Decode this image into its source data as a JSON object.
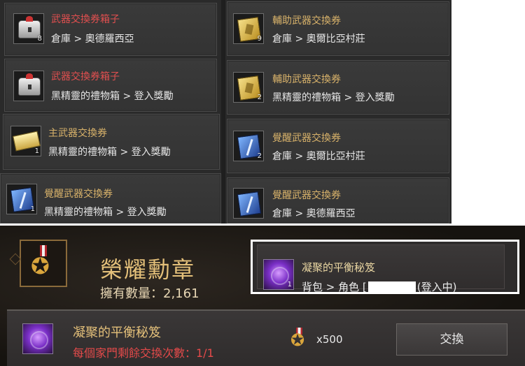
{
  "item_list": {
    "left": [
      {
        "name": "武器交換券箱子",
        "location": "倉庫 > 奧德羅西亞",
        "count": "8",
        "icon": "chest-icon",
        "name_color": "#e14f4f"
      },
      {
        "name": "武器交換券箱子",
        "location": "黑精靈的禮物箱 > 登入獎勵",
        "count": "",
        "icon": "chest-icon",
        "name_color": "#e14f4f"
      },
      {
        "name": "主武器交換券",
        "location": "黑精靈的禮物箱 > 登入獎勵",
        "count": "1",
        "icon": "scroll-icon",
        "name_color": "#d8b26a"
      },
      {
        "name": "覺醒武器交換券",
        "location": "黑精靈的禮物箱 > 登入獎勵",
        "count": "1",
        "icon": "awakening-coupon-icon",
        "name_color": "#d8b26a"
      }
    ],
    "right": [
      {
        "name": "輔助武器交換券",
        "location": "倉庫 > 奧爾比亞村莊",
        "count": "9",
        "icon": "coupon-icon",
        "name_color": "#d8b26a"
      },
      {
        "name": "輔助武器交換券",
        "location": "黑精靈的禮物箱 > 登入獎勵",
        "count": "2",
        "icon": "coupon-icon",
        "name_color": "#d8b26a"
      },
      {
        "name": "覺醒武器交換券",
        "location": "倉庫 > 奧爾比亞村莊",
        "count": "2",
        "icon": "awakening-coupon-icon",
        "name_color": "#d8b26a"
      },
      {
        "name": "覺醒武器交換券",
        "location": "倉庫 > 奧德羅西亞",
        "count": "",
        "icon": "awakening-coupon-icon",
        "name_color": "#d8b26a"
      }
    ]
  },
  "medal": {
    "title": "榮耀勳章",
    "owned_label": "擁有數量：2,161",
    "icon": "medal-icon"
  },
  "tooltip": {
    "item_name": "凝聚的平衡秘笈",
    "count": "1",
    "location_prefix": "背包 > 角色 [",
    "location_suffix": "(登入中)"
  },
  "exchange": {
    "item_name": "凝聚的平衡秘笈",
    "limit_text": "每個家門剩餘交換次數：1/1",
    "cost": "x500",
    "button_label": "交換"
  }
}
